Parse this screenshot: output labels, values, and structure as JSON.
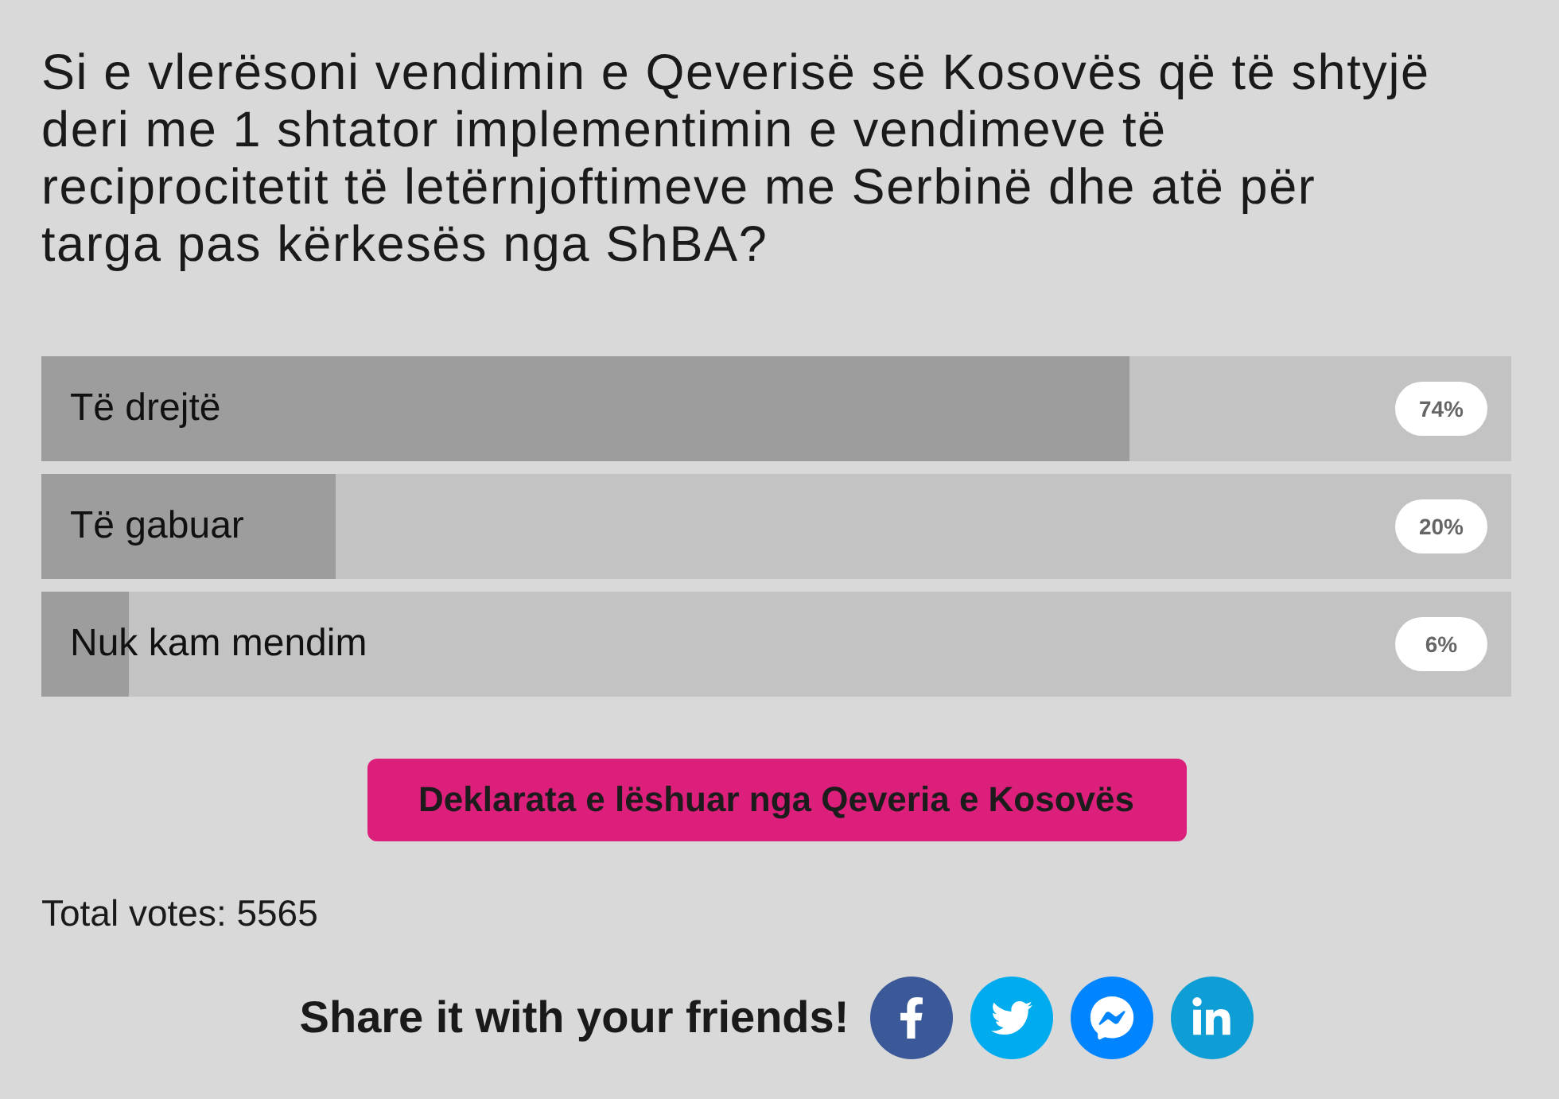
{
  "question": "Si e vlerësoni vendimin e Qeverisë së Kosovës që të shtyjë deri me 1 shtator implementimin e vendimeve të reciprocitetit të letërnjoftimeve me Serbinë dhe atë për targa pas kërkesës nga ShBA?",
  "options": [
    {
      "label": "Të drejtë",
      "level": 0.74,
      "percent": "74%"
    },
    {
      "label": "Të gabuar",
      "level": 0.2,
      "percent": "20%"
    },
    {
      "label": "Nuk kam mendim",
      "level": 0.06,
      "percent": "6%"
    }
  ],
  "button": {
    "label": "Deklarata e lëshuar nga Qeveria e Kosovës"
  },
  "total_votes": "Total votes: 5565",
  "share": {
    "label": "Share it with your friends!",
    "buttons": [
      {
        "kind": "facebook",
        "color": "#3b5998"
      },
      {
        "kind": "twitter",
        "color": "#00aced"
      },
      {
        "kind": "messenger",
        "color": "#0084ff"
      },
      {
        "kind": "linkedin",
        "color": "#0e9ed5"
      }
    ]
  }
}
